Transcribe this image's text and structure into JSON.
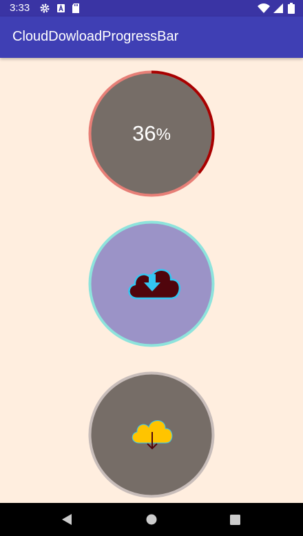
{
  "status_bar": {
    "time": "3:33",
    "icons": [
      "gear-icon",
      "a-badge-icon",
      "sd-card-icon",
      "wifi-icon",
      "signal-icon",
      "battery-icon"
    ]
  },
  "app_bar": {
    "title": "CloudDowloadProgressBar"
  },
  "progress_1": {
    "value": "36",
    "unit": "%",
    "progress_fraction": 0.36
  },
  "icons": {
    "button_2": "cloud-download-icon",
    "button_3": "cloud-download-arrow-icon"
  },
  "colors": {
    "status_bar": "#3A34A4",
    "app_bar": "#3F3FB4",
    "background": "#FFEEDF",
    "ring1_track": "#E77F77",
    "ring1_progress": "#A80000",
    "ring1_fill": "#766D67",
    "ring2_border": "#8EE3DC",
    "ring2_fill": "#9B93C7",
    "ring3_border": "#C8BDBA",
    "ring3_fill": "#766D67",
    "cloud_dark": "#50050C",
    "cloud_cyan": "#33C7F2",
    "cloud_yellow": "#FFC400"
  },
  "nav_bar": {
    "buttons": [
      "back",
      "home",
      "recents"
    ]
  }
}
